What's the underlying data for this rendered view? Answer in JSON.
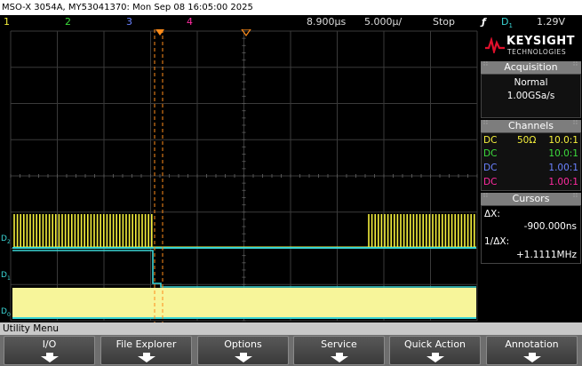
{
  "title_bar": {
    "text": "MSO-X 3054A, MY53041370: Mon Sep 08 16:05:00 2025"
  },
  "status": {
    "channel_1": "1",
    "channel_2": "2",
    "channel_3": "3",
    "channel_4": "4",
    "time_ref": "8.900µs",
    "time_div": "5.000µ/",
    "run_state": "Stop",
    "trigger_symbol": "ƒ",
    "trigger_source": "D",
    "trigger_source_sub": "1",
    "trigger_level": "1.29V"
  },
  "brand": {
    "name": "KEYSIGHT",
    "tagline": "TECHNOLOGIES"
  },
  "acquisition": {
    "header": "Acquisition",
    "mode": "Normal",
    "rate": "1.00GSa/s"
  },
  "channels": {
    "header": "Channels",
    "rows": [
      {
        "coupling": "DC",
        "impedance": "50Ω",
        "probe": "10.0:1",
        "color": "#f5f03c"
      },
      {
        "coupling": "DC",
        "impedance": "",
        "probe": "10.0:1",
        "color": "#3cdc3c"
      },
      {
        "coupling": "DC",
        "impedance": "",
        "probe": "1.00:1",
        "color": "#6a82ff"
      },
      {
        "coupling": "DC",
        "impedance": "",
        "probe": "1.00:1",
        "color": "#ff2aa0"
      }
    ]
  },
  "cursors": {
    "header": "Cursors",
    "delta_x_label": "ΔX:",
    "delta_x_value": "-900.000ns",
    "inv_delta_x_label": "1/ΔX:",
    "inv_delta_x_value": "+1.1111MHz"
  },
  "digital_labels": {
    "d2": "D",
    "d2_sub": "2",
    "d1": "D",
    "d1_sub": "1",
    "d0": "D",
    "d0_sub": "0"
  },
  "menu": {
    "title": "Utility Menu",
    "softkeys": [
      "I/O",
      "File Explorer",
      "Options",
      "Service",
      "Quick Action",
      "Annotation"
    ]
  },
  "colors": {
    "ch1": "#f5f03c",
    "ch2": "#3cdc3c",
    "ch3": "#6a82ff",
    "ch4": "#ff2aa0",
    "digital": "#3ad6d6",
    "trigger_marker": "#ff8c1a",
    "brand_red": "#e0102c"
  }
}
